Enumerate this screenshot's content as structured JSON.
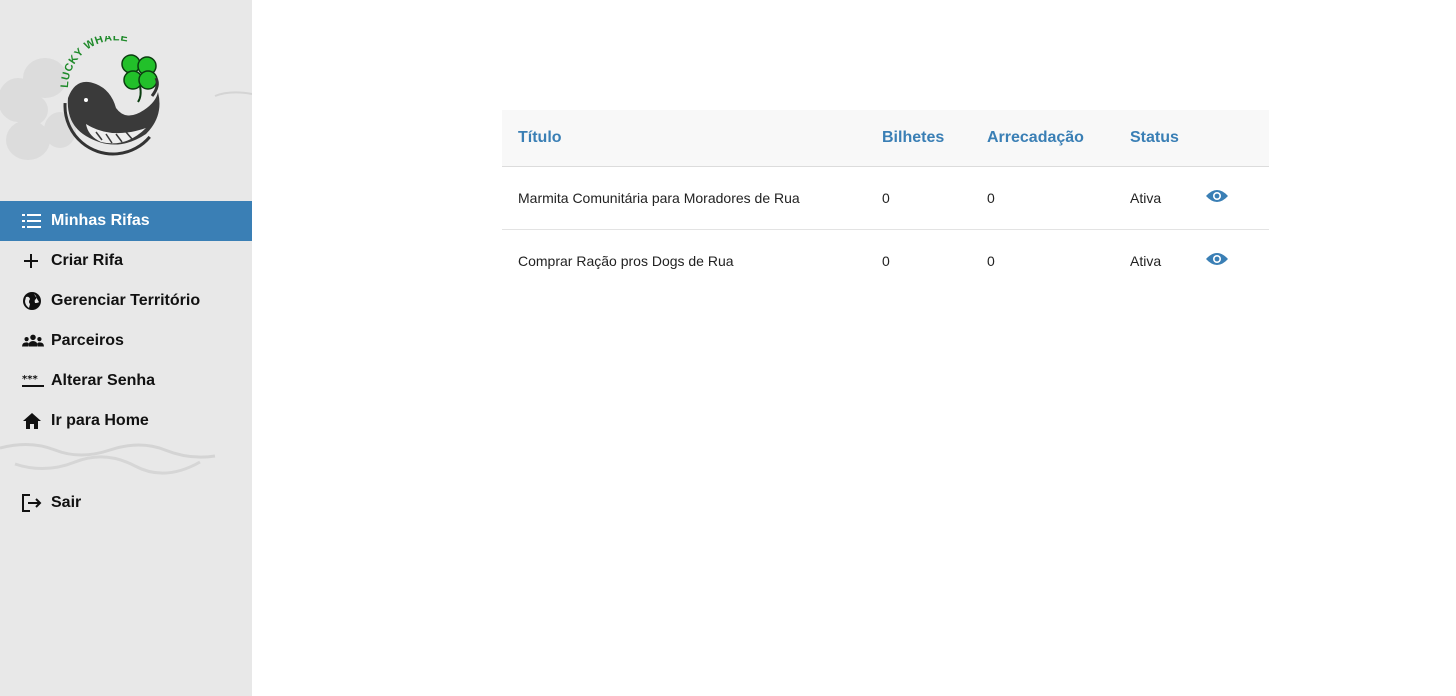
{
  "app": {
    "logo_text": "LUCKY WHALE"
  },
  "colors": {
    "accent": "#3a7fb5",
    "sidebar_bg": "#e8e8e8",
    "clover_green": "#22c02a"
  },
  "sidebar": {
    "items": [
      {
        "label": "Minhas Rifas",
        "icon": "list-icon",
        "active": true
      },
      {
        "label": "Criar Rifa",
        "icon": "plus-icon",
        "active": false
      },
      {
        "label": "Gerenciar Território",
        "icon": "globe-icon",
        "active": false
      },
      {
        "label": "Parceiros",
        "icon": "people-icon",
        "active": false
      },
      {
        "label": "Alterar Senha",
        "icon": "password-icon",
        "active": false
      },
      {
        "label": "Ir para Home",
        "icon": "home-icon",
        "active": false
      }
    ],
    "logout": {
      "label": "Sair",
      "icon": "logout-icon"
    }
  },
  "table": {
    "headers": {
      "title": "Título",
      "tickets": "Bilhetes",
      "raised": "Arrecadação",
      "status": "Status"
    },
    "rows": [
      {
        "title": "Marmita Comunitária para Moradores de Rua",
        "tickets": "0",
        "raised": "0",
        "status": "Ativa",
        "action_icon": "eye-icon"
      },
      {
        "title": "Comprar Ração pros Dogs de Rua",
        "tickets": "0",
        "raised": "0",
        "status": "Ativa",
        "action_icon": "eye-icon"
      }
    ]
  }
}
